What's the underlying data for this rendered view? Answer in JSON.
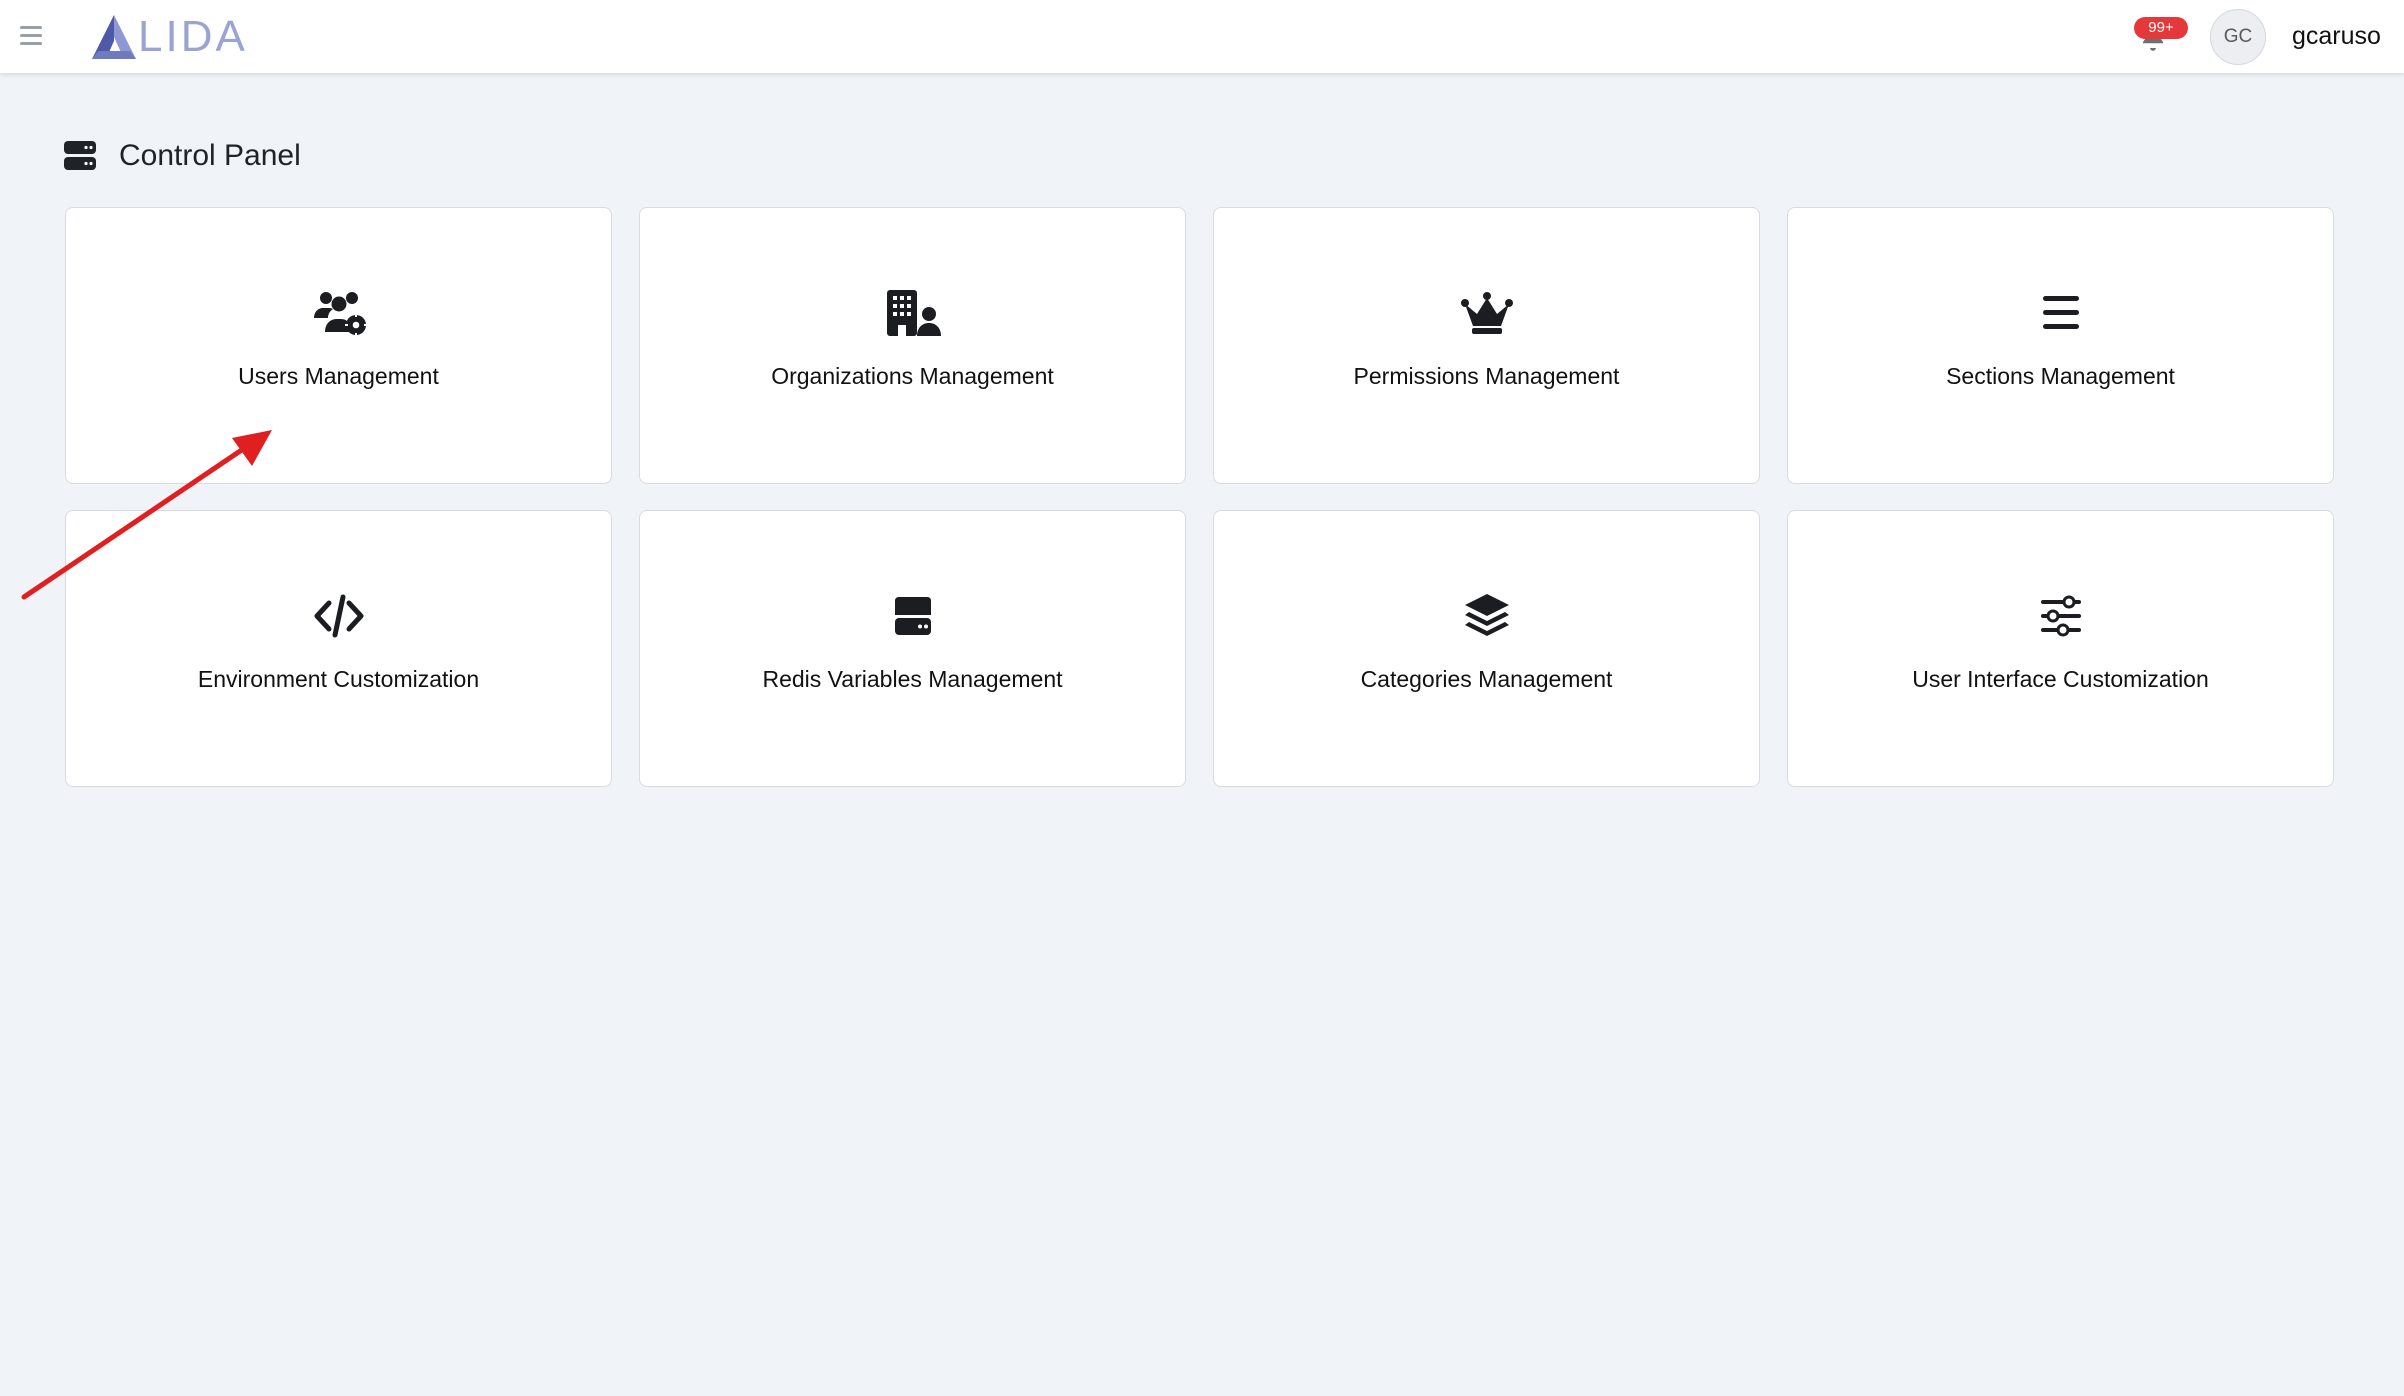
{
  "app": {
    "logo_text": "LIDA"
  },
  "header": {
    "notification_badge": "99+",
    "avatar_initials": "GC",
    "username": "gcaruso"
  },
  "page": {
    "title": "Control Panel"
  },
  "cards": [
    {
      "label": "Users Management",
      "icon": "users-gear-icon"
    },
    {
      "label": "Organizations Management",
      "icon": "building-user-icon"
    },
    {
      "label": "Permissions Management",
      "icon": "crown-icon"
    },
    {
      "label": "Sections Management",
      "icon": "list-icon"
    },
    {
      "label": "Environment Customization",
      "icon": "code-icon"
    },
    {
      "label": "Redis Variables Management",
      "icon": "hard-drive-icon"
    },
    {
      "label": "Categories Management",
      "icon": "layer-group-icon"
    },
    {
      "label": "User Interface Customization",
      "icon": "sliders-icon"
    }
  ],
  "colors": {
    "background": "#f0f3f8",
    "badge": "#e5383b",
    "logo": "#6f7bbf",
    "annotation_arrow": "#e02020"
  }
}
